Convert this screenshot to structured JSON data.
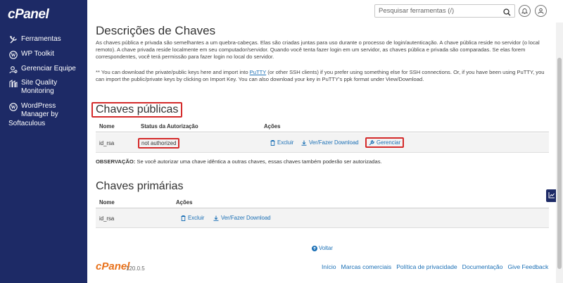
{
  "brand": {
    "logo": "cPanel"
  },
  "sidebar": {
    "items": [
      {
        "label": "Ferramentas",
        "icon": "tools-icon"
      },
      {
        "label": "WP Toolkit",
        "icon": "wordpress-icon"
      },
      {
        "label": "Gerenciar Equipe",
        "icon": "team-icon"
      },
      {
        "label": "Site Quality\nMonitoring",
        "icon": "monitoring-icon"
      },
      {
        "label": "WordPress\nManager by",
        "icon": "wordpress-icon"
      }
    ],
    "softaculous": "Softaculous"
  },
  "topbar": {
    "search_placeholder": "Pesquisar ferramentas (/)"
  },
  "page": {
    "title": "Descrições de Chaves",
    "intro": "As chaves pública e privada são semelhantes a um quebra-cabeças. Elas são criadas juntas para uso durante o processo de login/autenticação. A chave pública reside no servidor (o local remoto). A chave privada reside localmente em seu computador/servidor. Quando você tenta fazer login em um servidor, as chaves pública e privada são comparadas. Se elas forem correspondentes, você terá permissão para fazer login no local do servidor.",
    "putty_before": "** You can download the private/public keys here and import into ",
    "putty_link": "PuTTY",
    "putty_after": " (or other SSH clients) if you prefer using something else for SSH connections. Or, if you have been using PuTTY, you can import the public/private keys by clicking on Import Key. You can also download your key in PuTTY's ppk format under View/Download."
  },
  "public_keys": {
    "title": "Chaves públicas",
    "headers": {
      "name": "Nome",
      "status": "Status da Autorização",
      "actions": "Ações"
    },
    "rows": [
      {
        "name": "id_rsa",
        "status": "not authorized",
        "delete": "Excluir",
        "view": "Ver/Fazer Download",
        "manage": "Gerenciar"
      }
    ],
    "note_label": "OBSERVAÇÃO:",
    "note_text": " Se você autorizar uma chave idêntica a outras chaves, essas chaves também poderão ser autorizadas."
  },
  "private_keys": {
    "title": "Chaves primárias",
    "headers": {
      "name": "Nome",
      "actions": "Ações"
    },
    "rows": [
      {
        "name": "id_rsa",
        "delete": "Excluir",
        "view": "Ver/Fazer Download"
      }
    ]
  },
  "back": "Voltar",
  "footer": {
    "logo": "cPanel",
    "version": "120.0.5",
    "links": [
      "Início",
      "Marcas comerciais",
      "Política de privacidade",
      "Documentação",
      "Give Feedback"
    ]
  },
  "colors": {
    "sidebar": "#1d2a66",
    "link": "#1a6fb5",
    "highlight": "#d42a2a",
    "footer_logo": "#e8711a"
  }
}
